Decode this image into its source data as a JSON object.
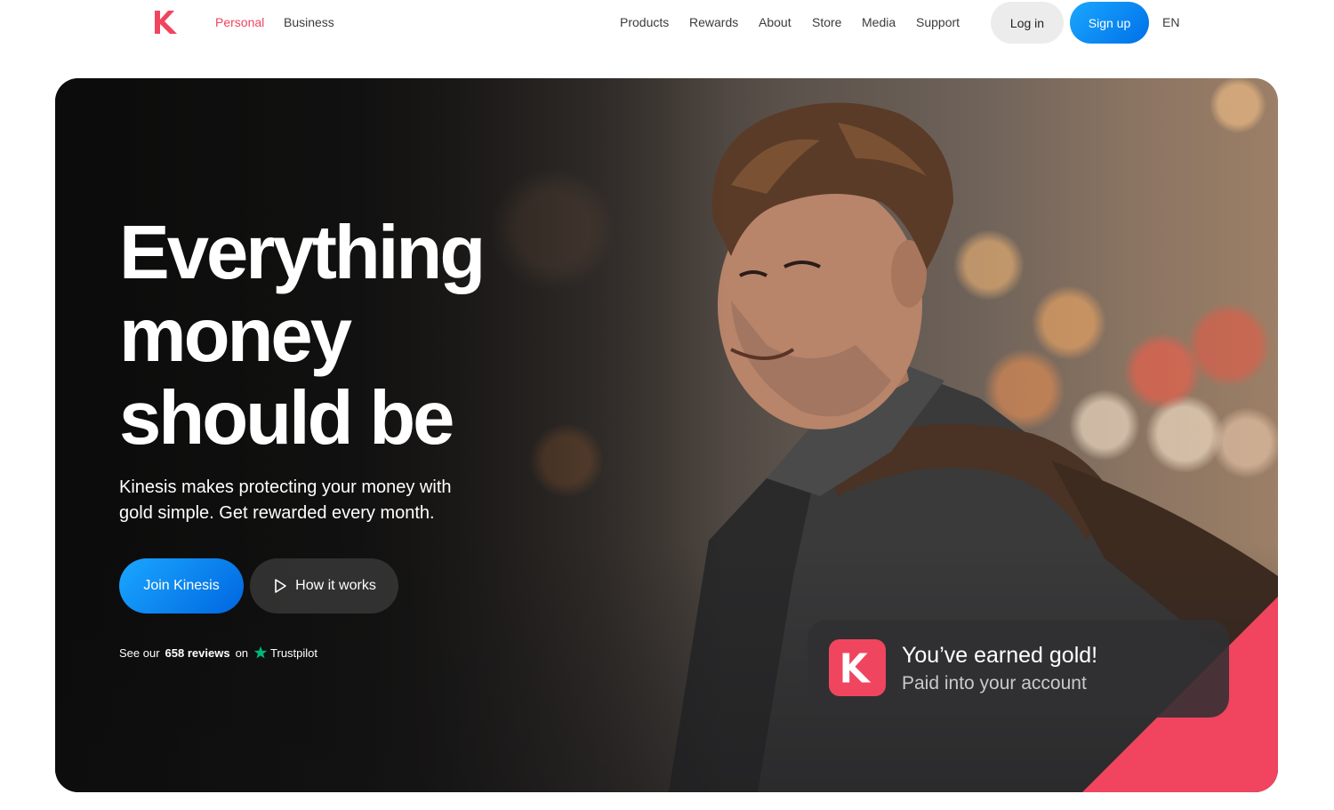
{
  "header": {
    "logo_icon": "kinesis-k-logo",
    "segments": [
      "Personal",
      "Business"
    ],
    "active_segment": "Personal",
    "nav": [
      "Products",
      "Rewards",
      "About",
      "Store",
      "Media",
      "Support"
    ],
    "login_label": "Log in",
    "signup_label": "Sign up",
    "language": "EN"
  },
  "hero": {
    "headline_lines": [
      "Everything",
      "money",
      "should be"
    ],
    "subtitle_lines": [
      "Kinesis makes protecting your money with",
      "gold simple. Get rewarded every month."
    ],
    "join_label": "Join Kinesis",
    "how_label": "How it works",
    "reviews_prefix": "See our",
    "reviews_count": "658 reviews",
    "reviews_suffix": "on",
    "trustpilot": "Trustpilot"
  },
  "notification": {
    "title": "You’ve earned gold!",
    "subtitle": "Paid into your account"
  },
  "colors": {
    "brand_pink": "#f0445f",
    "brand_blue": "#0a86f0",
    "trustpilot_green": "#00b67a"
  }
}
